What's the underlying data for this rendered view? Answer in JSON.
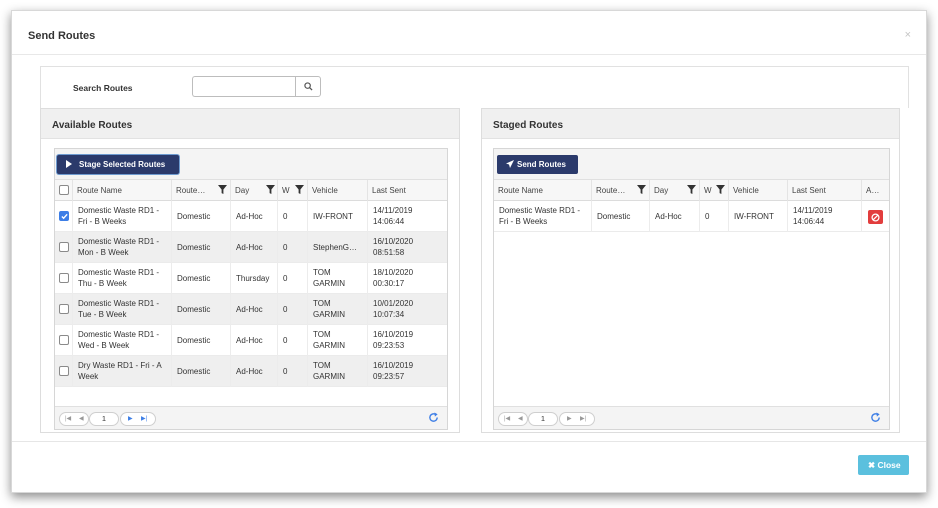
{
  "dialog": {
    "title": "Send Routes",
    "close_x": "×"
  },
  "search": {
    "label": "Search Routes",
    "value": ""
  },
  "available": {
    "title": "Available Routes",
    "stage_button": "Stage Selected Routes",
    "columns": [
      "Route Name",
      "Route…",
      "Day",
      "W",
      "Vehicle",
      "Last Sent"
    ],
    "rows": [
      {
        "checked": true,
        "name_1": "Domestic Waste RD1 -",
        "name_2": "Fri - B Weeks",
        "type": "Domestic",
        "day": "Ad-Hoc",
        "w": "0",
        "veh_1": "IW-FRONT",
        "veh_2": "",
        "date": "14/11/2019",
        "time": "14:06:44"
      },
      {
        "checked": false,
        "name_1": "Domestic Waste RD1 -",
        "name_2": "Mon - B Week",
        "type": "Domestic",
        "day": "Ad-Hoc",
        "w": "0",
        "veh_1": "StephenG…",
        "veh_2": "",
        "date": "16/10/2020",
        "time": "08:51:58"
      },
      {
        "checked": false,
        "name_1": "Domestic Waste RD1 -",
        "name_2": "Thu - B Week",
        "type": "Domestic",
        "day": "Thursday",
        "w": "0",
        "veh_1": "TOM",
        "veh_2": "GARMIN",
        "date": "18/10/2020",
        "time": "00:30:17"
      },
      {
        "checked": false,
        "name_1": "Domestic Waste RD1 -",
        "name_2": "Tue - B Week",
        "type": "Domestic",
        "day": "Ad-Hoc",
        "w": "0",
        "veh_1": "TOM",
        "veh_2": "GARMIN",
        "date": "10/01/2020",
        "time": "10:07:34"
      },
      {
        "checked": false,
        "name_1": "Domestic Waste RD1 -",
        "name_2": "Wed - B Week",
        "type": "Domestic",
        "day": "Ad-Hoc",
        "w": "0",
        "veh_1": "TOM",
        "veh_2": "GARMIN",
        "date": "16/10/2019",
        "time": "09:23:53"
      },
      {
        "checked": false,
        "name_1": "Dry Waste RD1 - Fri - A",
        "name_2": "Week",
        "type": "Domestic",
        "day": "Ad-Hoc",
        "w": "0",
        "veh_1": "TOM",
        "veh_2": "GARMIN",
        "date": "16/10/2019",
        "time": "09:23:57"
      }
    ],
    "pager": {
      "page": "1"
    }
  },
  "staged": {
    "title": "Staged Routes",
    "send_button": "Send Routes",
    "columns": [
      "Route Name",
      "Route…",
      "Day",
      "W",
      "Vehicle",
      "Last Sent",
      "A…"
    ],
    "rows": [
      {
        "name_1": "Domestic Waste RD1 -",
        "name_2": "Fri - B Weeks",
        "type": "Domestic",
        "day": "Ad-Hoc",
        "w": "0",
        "veh_1": "IW-FRONT",
        "date": "14/11/2019",
        "time": "14:06:44"
      }
    ],
    "pager": {
      "page": "1"
    }
  },
  "footer": {
    "close_button": "✖ Close"
  },
  "colors": {
    "navy": "#2b3a6b",
    "info": "#5bc0de",
    "danger": "#e23d3d",
    "check": "#3d7ee6"
  }
}
